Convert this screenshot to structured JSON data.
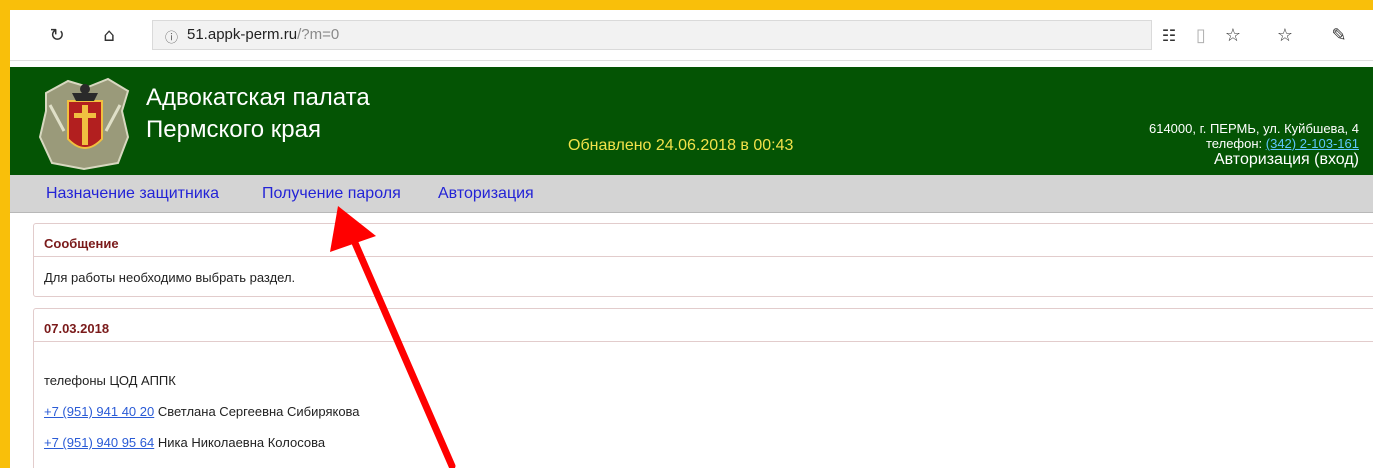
{
  "browser": {
    "url_host": "51.appk-perm.ru",
    "url_path": "/?m=0",
    "icons": [
      "refresh-icon",
      "home-icon",
      "info-icon",
      "extension-icon",
      "reading-view-icon",
      "favorite-star-icon",
      "favorites-list-icon",
      "pen-icon"
    ]
  },
  "header": {
    "title_line1": "Адвокатская палата",
    "title_line2": "Пермского края",
    "updated": "Обнавлено 24.06.2018 в 00:43",
    "address": "614000, г. ПЕРМЬ, ул. Куйбшева, 4",
    "phone_label": "телефон:",
    "phone": "(342) 2-103-161",
    "login": "Авторизация (вход)"
  },
  "nav": {
    "items": [
      {
        "label": "Назначение защитника"
      },
      {
        "label": "Получение пароля"
      },
      {
        "label": "Авторизация"
      }
    ]
  },
  "message": {
    "title": "Сообщение",
    "text": "Для работы необходимо выбрать раздел."
  },
  "news": {
    "date": "07.03.2018",
    "heading": "телефоны ЦОД АППК",
    "contacts": [
      {
        "phone": "+7 (951) 941 40 20",
        "name": "Светлана Сергеевна Сибирякова"
      },
      {
        "phone": "+7 (951) 940 95 64",
        "name": "Ника Николаевна Колосова"
      }
    ]
  },
  "colors": {
    "frame": "#f9bf0a",
    "header_bg": "#045404",
    "updated_text": "#f2e24a",
    "nav_bg": "#d4d4d4",
    "nav_link": "#2323d6",
    "panel_title": "#7a1a1a",
    "arrow": "#ff0000"
  }
}
